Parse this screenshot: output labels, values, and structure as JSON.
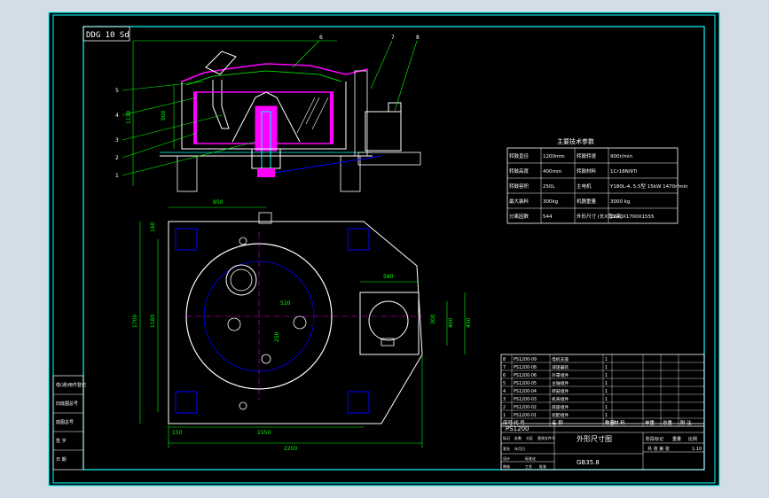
{
  "colors": {
    "frame_bg": "#d3dde7",
    "paper": "#000000",
    "border": "#00ffff",
    "outline": "#ffffff",
    "dim": "#00ff00",
    "magenta": "#ff00ff",
    "blue": "#0000ff",
    "table_text": "#ffffff"
  },
  "drawing_code": "DDG 10 Sd",
  "leaders": [
    "1",
    "2",
    "2",
    "3",
    "4",
    "5",
    "6",
    "7",
    "8"
  ],
  "front_dims": [
    "900",
    "1130"
  ],
  "plan_dims": {
    "top_offset": "850",
    "left_inner": "1180",
    "left_outer": "1700",
    "top_left": "160",
    "motor_w": "580",
    "r_inner": "520",
    "r_small": "250",
    "motor_h_inner": "400",
    "motor_h_outer": "450",
    "motor_h_mid": "300",
    "bottom_left": "150",
    "bottom_mid": "1550",
    "bottom_total": "2200"
  },
  "spec_table": {
    "title": "主要技术参数",
    "rows": [
      [
        "转鼓直径",
        "1200mm",
        "转鼓转速",
        "900r/min"
      ],
      [
        "转鼓高度",
        "400mm",
        "转鼓材料",
        "1Cr18Ni9Ti"
      ],
      [
        "转鼓容积",
        "250L",
        "主电机",
        "Y180L-4, 5.5型 15kW 1470r/min"
      ],
      [
        "最大装料",
        "300kg",
        "机器重量",
        "3000 kg"
      ],
      [
        "分离因数",
        "544",
        "外形尺寸 (长X宽X高)",
        "2200X1700X1555"
      ]
    ]
  },
  "left_stamp": [
    "借(通)用件登记",
    "旧底图总号",
    "底图总号",
    "签 字",
    "日 期"
  ],
  "bom": {
    "rows": [
      [
        "8",
        "PS1200-09",
        "电机支座",
        "1",
        ""
      ],
      [
        "7",
        "PS1200-08",
        "减速器装",
        "1",
        ""
      ],
      [
        "6",
        "PS1200-06",
        "外罩组件",
        "1",
        ""
      ],
      [
        "5",
        "PS1200-05",
        "主轴组件",
        "1",
        ""
      ],
      [
        "4",
        "PS1200-04",
        "转鼓组件",
        "1",
        ""
      ],
      [
        "3",
        "PS1200-03",
        "机壳组件",
        "1",
        ""
      ],
      [
        "2",
        "PS1200-02",
        "底座组件",
        "1",
        ""
      ],
      [
        "1",
        "PS1200-01",
        "装配组件",
        "1",
        ""
      ]
    ],
    "header": [
      "序号",
      "代 号",
      "名 称",
      "数量",
      "材 料",
      "单重",
      "总重",
      "附 注"
    ]
  },
  "title_block": {
    "model": "PS1200",
    "drawing_title": "外形尺寸图",
    "scale": "1:10",
    "labels": [
      "标记",
      "处数",
      "分区",
      "更改文件号",
      "签名",
      "年月日",
      "设计",
      "标准化",
      "审核",
      "工艺",
      "批准"
    ],
    "stage_labels": [
      "阶段标记",
      "重量",
      "比例"
    ],
    "sheet": "共 张 第 张",
    "doc": "GB35.8"
  }
}
